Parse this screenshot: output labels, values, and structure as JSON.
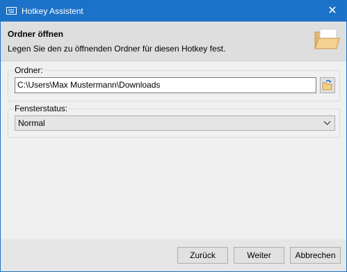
{
  "window": {
    "title": "Hotkey Assistent",
    "close_glyph": "✕",
    "app_icon": "keyboard-icon",
    "accent_color": "#1c72c8"
  },
  "header": {
    "title": "Ordner öffnen",
    "description": "Legen Sie den zu öffnenden Ordner für diesen Hotkey fest.",
    "icon": "folder-open-icon"
  },
  "folder_group": {
    "label": "Ordner:",
    "value": "C:\\Users\\Max Mustermann\\Downloads",
    "browse_icon": "browse-folder-icon"
  },
  "window_state_group": {
    "label": "Fensterstatus:",
    "selected": "Normal"
  },
  "footer": {
    "back_label": "Zurück",
    "next_label": "Weiter",
    "cancel_label": "Abbrechen"
  }
}
